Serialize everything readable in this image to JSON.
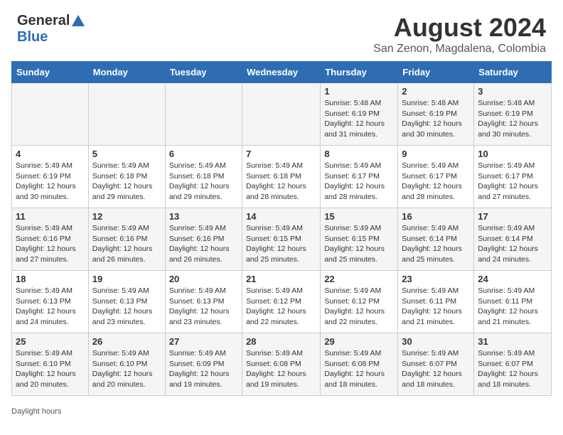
{
  "header": {
    "logo_general": "General",
    "logo_blue": "Blue",
    "main_title": "August 2024",
    "subtitle": "San Zenon, Magdalena, Colombia"
  },
  "calendar": {
    "days_of_week": [
      "Sunday",
      "Monday",
      "Tuesday",
      "Wednesday",
      "Thursday",
      "Friday",
      "Saturday"
    ],
    "weeks": [
      [
        {
          "day": "",
          "info": ""
        },
        {
          "day": "",
          "info": ""
        },
        {
          "day": "",
          "info": ""
        },
        {
          "day": "",
          "info": ""
        },
        {
          "day": "1",
          "info": "Sunrise: 5:48 AM\nSunset: 6:19 PM\nDaylight: 12 hours and 31 minutes."
        },
        {
          "day": "2",
          "info": "Sunrise: 5:48 AM\nSunset: 6:19 PM\nDaylight: 12 hours and 30 minutes."
        },
        {
          "day": "3",
          "info": "Sunrise: 5:48 AM\nSunset: 6:19 PM\nDaylight: 12 hours and 30 minutes."
        }
      ],
      [
        {
          "day": "4",
          "info": "Sunrise: 5:49 AM\nSunset: 6:19 PM\nDaylight: 12 hours and 30 minutes."
        },
        {
          "day": "5",
          "info": "Sunrise: 5:49 AM\nSunset: 6:18 PM\nDaylight: 12 hours and 29 minutes."
        },
        {
          "day": "6",
          "info": "Sunrise: 5:49 AM\nSunset: 6:18 PM\nDaylight: 12 hours and 29 minutes."
        },
        {
          "day": "7",
          "info": "Sunrise: 5:49 AM\nSunset: 6:18 PM\nDaylight: 12 hours and 28 minutes."
        },
        {
          "day": "8",
          "info": "Sunrise: 5:49 AM\nSunset: 6:17 PM\nDaylight: 12 hours and 28 minutes."
        },
        {
          "day": "9",
          "info": "Sunrise: 5:49 AM\nSunset: 6:17 PM\nDaylight: 12 hours and 28 minutes."
        },
        {
          "day": "10",
          "info": "Sunrise: 5:49 AM\nSunset: 6:17 PM\nDaylight: 12 hours and 27 minutes."
        }
      ],
      [
        {
          "day": "11",
          "info": "Sunrise: 5:49 AM\nSunset: 6:16 PM\nDaylight: 12 hours and 27 minutes."
        },
        {
          "day": "12",
          "info": "Sunrise: 5:49 AM\nSunset: 6:16 PM\nDaylight: 12 hours and 26 minutes."
        },
        {
          "day": "13",
          "info": "Sunrise: 5:49 AM\nSunset: 6:16 PM\nDaylight: 12 hours and 26 minutes."
        },
        {
          "day": "14",
          "info": "Sunrise: 5:49 AM\nSunset: 6:15 PM\nDaylight: 12 hours and 25 minutes."
        },
        {
          "day": "15",
          "info": "Sunrise: 5:49 AM\nSunset: 6:15 PM\nDaylight: 12 hours and 25 minutes."
        },
        {
          "day": "16",
          "info": "Sunrise: 5:49 AM\nSunset: 6:14 PM\nDaylight: 12 hours and 25 minutes."
        },
        {
          "day": "17",
          "info": "Sunrise: 5:49 AM\nSunset: 6:14 PM\nDaylight: 12 hours and 24 minutes."
        }
      ],
      [
        {
          "day": "18",
          "info": "Sunrise: 5:49 AM\nSunset: 6:13 PM\nDaylight: 12 hours and 24 minutes."
        },
        {
          "day": "19",
          "info": "Sunrise: 5:49 AM\nSunset: 6:13 PM\nDaylight: 12 hours and 23 minutes."
        },
        {
          "day": "20",
          "info": "Sunrise: 5:49 AM\nSunset: 6:13 PM\nDaylight: 12 hours and 23 minutes."
        },
        {
          "day": "21",
          "info": "Sunrise: 5:49 AM\nSunset: 6:12 PM\nDaylight: 12 hours and 22 minutes."
        },
        {
          "day": "22",
          "info": "Sunrise: 5:49 AM\nSunset: 6:12 PM\nDaylight: 12 hours and 22 minutes."
        },
        {
          "day": "23",
          "info": "Sunrise: 5:49 AM\nSunset: 6:11 PM\nDaylight: 12 hours and 21 minutes."
        },
        {
          "day": "24",
          "info": "Sunrise: 5:49 AM\nSunset: 6:11 PM\nDaylight: 12 hours and 21 minutes."
        }
      ],
      [
        {
          "day": "25",
          "info": "Sunrise: 5:49 AM\nSunset: 6:10 PM\nDaylight: 12 hours and 20 minutes."
        },
        {
          "day": "26",
          "info": "Sunrise: 5:49 AM\nSunset: 6:10 PM\nDaylight: 12 hours and 20 minutes."
        },
        {
          "day": "27",
          "info": "Sunrise: 5:49 AM\nSunset: 6:09 PM\nDaylight: 12 hours and 19 minutes."
        },
        {
          "day": "28",
          "info": "Sunrise: 5:49 AM\nSunset: 6:08 PM\nDaylight: 12 hours and 19 minutes."
        },
        {
          "day": "29",
          "info": "Sunrise: 5:49 AM\nSunset: 6:08 PM\nDaylight: 12 hours and 18 minutes."
        },
        {
          "day": "30",
          "info": "Sunrise: 5:49 AM\nSunset: 6:07 PM\nDaylight: 12 hours and 18 minutes."
        },
        {
          "day": "31",
          "info": "Sunrise: 5:49 AM\nSunset: 6:07 PM\nDaylight: 12 hours and 18 minutes."
        }
      ]
    ]
  },
  "footer": {
    "text": "Daylight hours"
  }
}
